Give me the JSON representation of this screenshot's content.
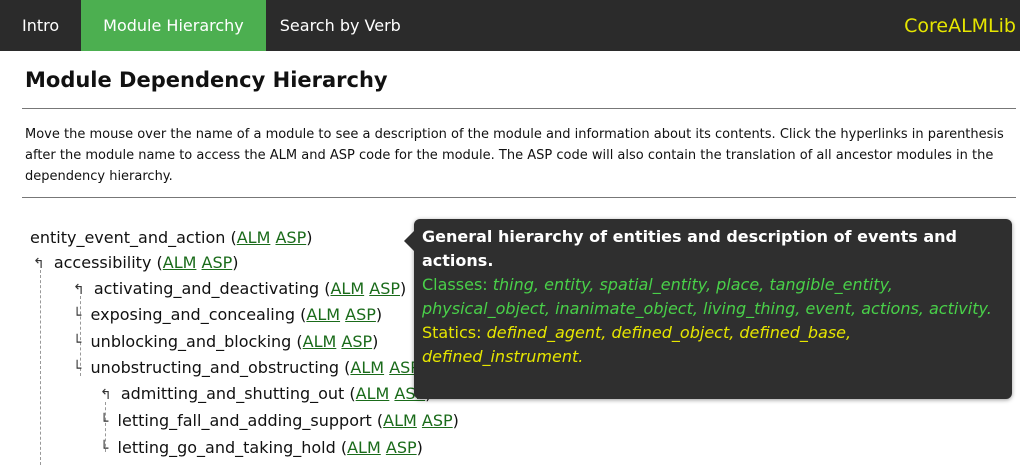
{
  "nav": {
    "tabs": [
      {
        "label": "Intro"
      },
      {
        "label": "Module Hierarchy"
      },
      {
        "label": "Search by Verb"
      }
    ],
    "brand": "CoreALMLib"
  },
  "page": {
    "title": "Module Dependency Hierarchy",
    "intro": "Move the mouse over the name of a module to see a description of the module and information about its contents. Click the hyperlinks in parenthesis after the module name to access the ALM and ASP code for the module. The ASP code will also contain the translation of all ancestor modules in the dependency hierarchy."
  },
  "tree": {
    "link_alm": "ALM",
    "link_asp": "ASP",
    "nodes": [
      {
        "name": "entity_event_and_action"
      },
      {
        "name": "accessibility"
      },
      {
        "name": "activating_and_deactivating"
      },
      {
        "name": "exposing_and_concealing"
      },
      {
        "name": "unblocking_and_blocking"
      },
      {
        "name": "unobstructing_and_obstructing"
      },
      {
        "name": "admitting_and_shutting_out"
      },
      {
        "name": "letting_fall_and_adding_support"
      },
      {
        "name": "letting_go_and_taking_hold"
      }
    ]
  },
  "tooltip": {
    "title": "General hierarchy of entities and description of events and actions.",
    "classes_label": "Classes:",
    "classes": "thing, entity, spatial_entity, place, tangible_entity, physical_object, inanimate_object, living_thing, event, actions, activity.",
    "statics_label": "Statics:",
    "statics": "defined_agent, defined_object, defined_base, defined_instrument."
  },
  "colors": {
    "nav_bg": "#2b2b2b",
    "active_tab": "#4caf50",
    "brand": "#e6e600",
    "link": "#1a6b1a",
    "tooltip_bg": "#2f2f2f",
    "tooltip_classes": "#49d049",
    "tooltip_statics": "#e6e600"
  }
}
